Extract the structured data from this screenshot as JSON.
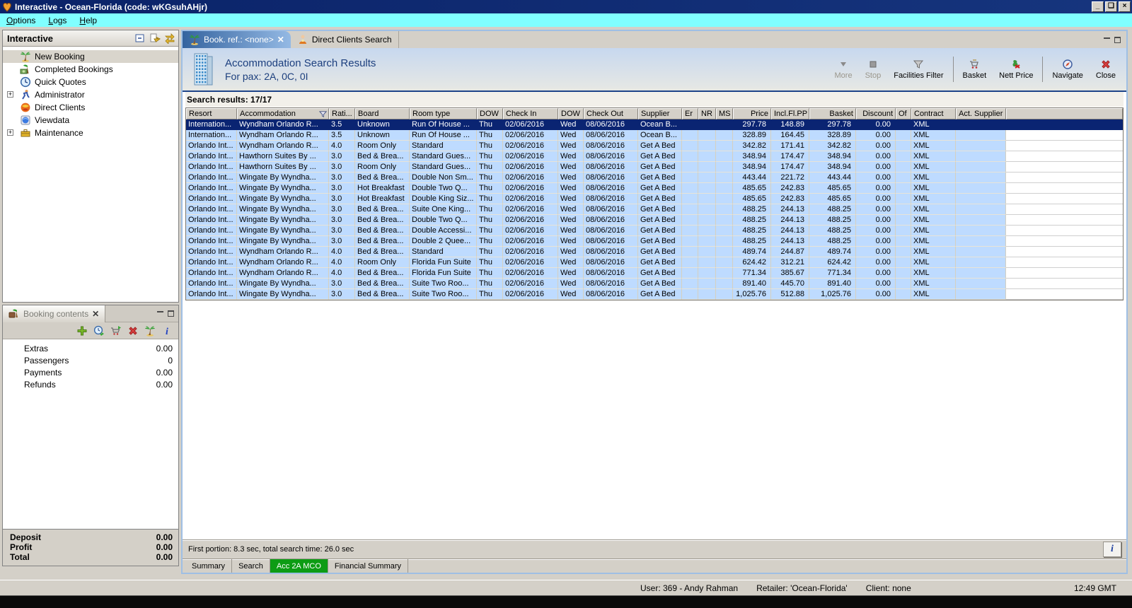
{
  "window": {
    "title": "Interactive - Ocean-Florida (code: wKGsuhAHjr)",
    "controls": [
      {
        "name": "minimize-button",
        "glyph": "_"
      },
      {
        "name": "restore-button",
        "glyph": "❏"
      },
      {
        "name": "close-button",
        "glyph": "×"
      }
    ]
  },
  "menubar": {
    "items": [
      "Options",
      "Logs",
      "Help"
    ]
  },
  "sidebar": {
    "title": "Interactive",
    "header_tools": [
      "collapse-box-icon",
      "link-editor-icon",
      "sync-arrows-icon"
    ],
    "items": [
      {
        "icon": "palm-icon",
        "label": "New Booking",
        "selected": true,
        "expandable": false
      },
      {
        "icon": "money-icon",
        "label": "Completed Bookings",
        "expandable": false
      },
      {
        "icon": "clock-icon",
        "label": "Quick Quotes",
        "expandable": false
      },
      {
        "icon": "runner-icon",
        "label": "Administrator",
        "expandable": true
      },
      {
        "icon": "globe-fire-icon",
        "label": "Direct Clients",
        "expandable": false
      },
      {
        "icon": "viewdata-icon",
        "label": "Viewdata",
        "expandable": false
      },
      {
        "icon": "toolbox-icon",
        "label": "Maintenance",
        "expandable": true
      }
    ]
  },
  "booking": {
    "tab_label": "Booking contents",
    "toolbar_icons": [
      "add-icon",
      "refresh-clock-icon",
      "cart-go-icon",
      "delete-icon",
      "palm-icon",
      "info-icon"
    ],
    "rows": [
      {
        "label": "Extras",
        "value": "0.00"
      },
      {
        "label": "Passengers",
        "value": "0"
      },
      {
        "label": "Payments",
        "value": "0.00"
      },
      {
        "label": "Refunds",
        "value": "0.00"
      }
    ],
    "footer": [
      {
        "label": "Deposit",
        "value": "0.00"
      },
      {
        "label": "Profit",
        "value": "0.00"
      },
      {
        "label": "Total",
        "value": "0.00"
      }
    ]
  },
  "editor": {
    "tabs": [
      {
        "icon": "palm-icon",
        "label": "Book. ref.: <none>",
        "close": true,
        "active": true
      },
      {
        "icon": "person-icon",
        "label": "Direct Clients Search",
        "close": false,
        "active": false
      }
    ],
    "header": {
      "icon": "building-icon",
      "title": "Accommodation Search Results",
      "subtitle": "For pax: 2A, 0C, 0I"
    },
    "toolbar": [
      {
        "icon": "more-icon",
        "label": "More",
        "disabled": true
      },
      {
        "icon": "stop-icon",
        "label": "Stop",
        "disabled": true
      },
      {
        "icon": "funnel-icon",
        "label": "Facilities Filter",
        "disabled": false
      },
      {
        "separator": true
      },
      {
        "icon": "basket-icon",
        "label": "Basket",
        "disabled": false
      },
      {
        "icon": "nett-price-icon",
        "label": "Nett Price",
        "disabled": false
      },
      {
        "separator": true
      },
      {
        "icon": "navigate-icon",
        "label": "Navigate",
        "disabled": false
      },
      {
        "icon": "close-red-icon",
        "label": "Close",
        "disabled": false
      }
    ],
    "results_label": "Search results: 17/17",
    "table": {
      "columns": [
        {
          "label": "Resort"
        },
        {
          "label": "Accommodation",
          "icon": "funnel-small-icon"
        },
        {
          "label": "Rati..."
        },
        {
          "label": "Board"
        },
        {
          "label": "Room type"
        },
        {
          "label": "DOW"
        },
        {
          "label": "Check In"
        },
        {
          "label": "DOW"
        },
        {
          "label": "Check Out"
        },
        {
          "label": "Supplier"
        },
        {
          "label": "Er"
        },
        {
          "label": "NR"
        },
        {
          "label": "MS"
        },
        {
          "label": "Price",
          "align": "right"
        },
        {
          "label": "Incl.Fl.PP",
          "align": "right"
        },
        {
          "label": "Basket",
          "align": "right",
          "sort": true
        },
        {
          "label": "Discount",
          "align": "right"
        },
        {
          "label": "Of"
        },
        {
          "label": "Contract"
        },
        {
          "label": "Act. Supplier"
        }
      ],
      "selected_row": 0,
      "rows": [
        [
          "Internation...",
          "Wyndham Orlando R...",
          "3.5",
          "Unknown",
          "Run Of House ...",
          "Thu",
          "02/06/2016",
          "Wed",
          "08/06/2016",
          "Ocean B...",
          "",
          "",
          "",
          "297.78",
          "148.89",
          "297.78",
          "0.00",
          "",
          "XML",
          ""
        ],
        [
          "Internation...",
          "Wyndham Orlando R...",
          "3.5",
          "Unknown",
          "Run Of House ...",
          "Thu",
          "02/06/2016",
          "Wed",
          "08/06/2016",
          "Ocean B...",
          "",
          "",
          "",
          "328.89",
          "164.45",
          "328.89",
          "0.00",
          "",
          "XML",
          ""
        ],
        [
          "Orlando Int...",
          "Wyndham Orlando R...",
          "4.0",
          "Room Only",
          "Standard",
          "Thu",
          "02/06/2016",
          "Wed",
          "08/06/2016",
          "Get A Bed",
          "",
          "",
          "",
          "342.82",
          "171.41",
          "342.82",
          "0.00",
          "",
          "XML",
          ""
        ],
        [
          "Orlando Int...",
          "Hawthorn Suites By ...",
          "3.0",
          "Bed & Brea...",
          "Standard Gues...",
          "Thu",
          "02/06/2016",
          "Wed",
          "08/06/2016",
          "Get A Bed",
          "",
          "",
          "",
          "348.94",
          "174.47",
          "348.94",
          "0.00",
          "",
          "XML",
          ""
        ],
        [
          "Orlando Int...",
          "Hawthorn Suites By ...",
          "3.0",
          "Room Only",
          "Standard Gues...",
          "Thu",
          "02/06/2016",
          "Wed",
          "08/06/2016",
          "Get A Bed",
          "",
          "",
          "",
          "348.94",
          "174.47",
          "348.94",
          "0.00",
          "",
          "XML",
          ""
        ],
        [
          "Orlando Int...",
          "Wingate By Wyndha...",
          "3.0",
          "Bed & Brea...",
          "Double Non Sm...",
          "Thu",
          "02/06/2016",
          "Wed",
          "08/06/2016",
          "Get A Bed",
          "",
          "",
          "",
          "443.44",
          "221.72",
          "443.44",
          "0.00",
          "",
          "XML",
          ""
        ],
        [
          "Orlando Int...",
          "Wingate By Wyndha...",
          "3.0",
          "Hot Breakfast",
          "Double Two Q...",
          "Thu",
          "02/06/2016",
          "Wed",
          "08/06/2016",
          "Get A Bed",
          "",
          "",
          "",
          "485.65",
          "242.83",
          "485.65",
          "0.00",
          "",
          "XML",
          ""
        ],
        [
          "Orlando Int...",
          "Wingate By Wyndha...",
          "3.0",
          "Hot Breakfast",
          "Double King Siz...",
          "Thu",
          "02/06/2016",
          "Wed",
          "08/06/2016",
          "Get A Bed",
          "",
          "",
          "",
          "485.65",
          "242.83",
          "485.65",
          "0.00",
          "",
          "XML",
          ""
        ],
        [
          "Orlando Int...",
          "Wingate By Wyndha...",
          "3.0",
          "Bed & Brea...",
          "Suite One King...",
          "Thu",
          "02/06/2016",
          "Wed",
          "08/06/2016",
          "Get A Bed",
          "",
          "",
          "",
          "488.25",
          "244.13",
          "488.25",
          "0.00",
          "",
          "XML",
          ""
        ],
        [
          "Orlando Int...",
          "Wingate By Wyndha...",
          "3.0",
          "Bed & Brea...",
          "Double Two Q...",
          "Thu",
          "02/06/2016",
          "Wed",
          "08/06/2016",
          "Get A Bed",
          "",
          "",
          "",
          "488.25",
          "244.13",
          "488.25",
          "0.00",
          "",
          "XML",
          ""
        ],
        [
          "Orlando Int...",
          "Wingate By Wyndha...",
          "3.0",
          "Bed & Brea...",
          "Double Accessi...",
          "Thu",
          "02/06/2016",
          "Wed",
          "08/06/2016",
          "Get A Bed",
          "",
          "",
          "",
          "488.25",
          "244.13",
          "488.25",
          "0.00",
          "",
          "XML",
          ""
        ],
        [
          "Orlando Int...",
          "Wingate By Wyndha...",
          "3.0",
          "Bed & Brea...",
          "Double 2 Quee...",
          "Thu",
          "02/06/2016",
          "Wed",
          "08/06/2016",
          "Get A Bed",
          "",
          "",
          "",
          "488.25",
          "244.13",
          "488.25",
          "0.00",
          "",
          "XML",
          ""
        ],
        [
          "Orlando Int...",
          "Wyndham Orlando R...",
          "4.0",
          "Bed & Brea...",
          "Standard",
          "Thu",
          "02/06/2016",
          "Wed",
          "08/06/2016",
          "Get A Bed",
          "",
          "",
          "",
          "489.74",
          "244.87",
          "489.74",
          "0.00",
          "",
          "XML",
          ""
        ],
        [
          "Orlando Int...",
          "Wyndham Orlando R...",
          "4.0",
          "Room Only",
          "Florida Fun Suite",
          "Thu",
          "02/06/2016",
          "Wed",
          "08/06/2016",
          "Get A Bed",
          "",
          "",
          "",
          "624.42",
          "312.21",
          "624.42",
          "0.00",
          "",
          "XML",
          ""
        ],
        [
          "Orlando Int...",
          "Wyndham Orlando R...",
          "4.0",
          "Bed & Brea...",
          "Florida Fun Suite",
          "Thu",
          "02/06/2016",
          "Wed",
          "08/06/2016",
          "Get A Bed",
          "",
          "",
          "",
          "771.34",
          "385.67",
          "771.34",
          "0.00",
          "",
          "XML",
          ""
        ],
        [
          "Orlando Int...",
          "Wingate By Wyndha...",
          "3.0",
          "Bed & Brea...",
          "Suite Two Roo...",
          "Thu",
          "02/06/2016",
          "Wed",
          "08/06/2016",
          "Get A Bed",
          "",
          "",
          "",
          "891.40",
          "445.70",
          "891.40",
          "0.00",
          "",
          "XML",
          ""
        ],
        [
          "Orlando Int...",
          "Wingate By Wyndha...",
          "3.0",
          "Bed & Brea...",
          "Suite Two Roo...",
          "Thu",
          "02/06/2016",
          "Wed",
          "08/06/2016",
          "Get A Bed",
          "",
          "",
          "",
          "1,025.76",
          "512.88",
          "1,025.76",
          "0.00",
          "",
          "XML",
          ""
        ]
      ]
    },
    "status_text": "First portion: 8.3 sec, total search time: 26.0 sec",
    "info_button": "i",
    "bottom_tabs": [
      {
        "label": "Summary",
        "active": false
      },
      {
        "label": "Search",
        "active": false
      },
      {
        "label": "Acc 2A MCO",
        "active": true
      },
      {
        "label": "Financial Summary",
        "active": false
      }
    ]
  },
  "statusbar": {
    "user": "User: 369 - Andy Rahman",
    "retailer": "Retailer: 'Ocean-Florida'",
    "client": "Client: none",
    "time": "12:49 GMT"
  },
  "colors": {
    "titlebar": "#0A2268",
    "menubar": "#80FFFF",
    "row_blue": "#BEDBFF",
    "selected_row": "#0A2472",
    "active_bottom_tab": "#0D9C14",
    "header_accent": "#1D4489"
  }
}
